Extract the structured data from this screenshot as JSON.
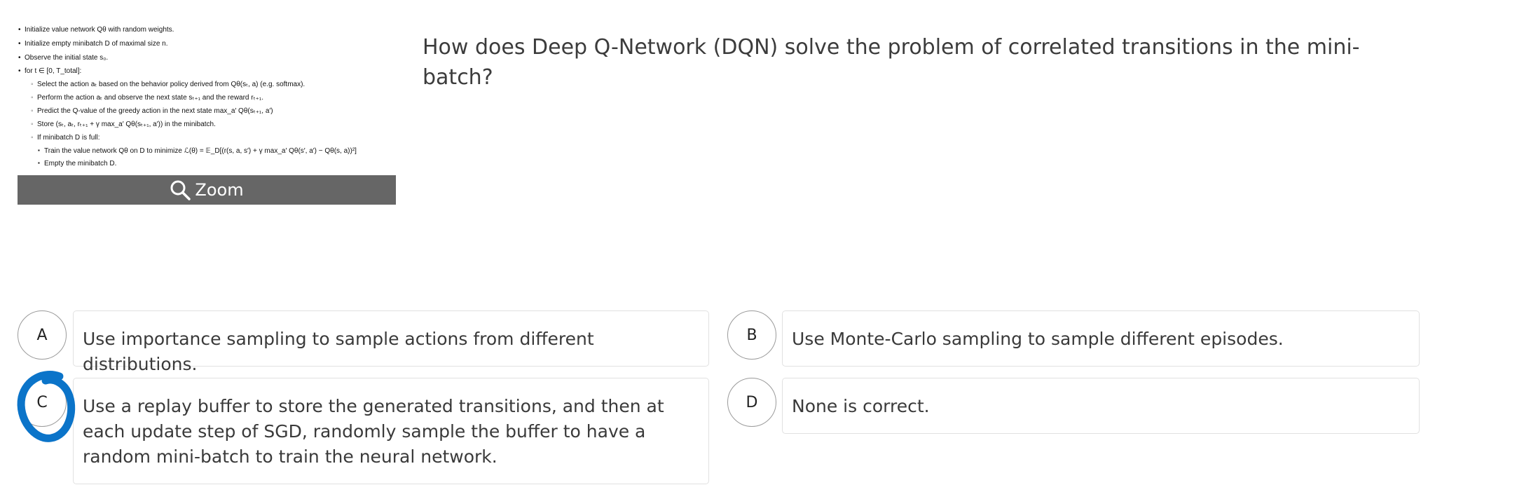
{
  "algorithm": {
    "lines": [
      "Initialize value network Qθ with random weights.",
      "Initialize empty minibatch D of maximal size n.",
      "Observe the initial state s₀.",
      "for t ∈ [0, T_total]:",
      "Select the action aₜ based on the behavior policy derived from Qθ(sₜ, a) (e.g. softmax).",
      "Perform the action aₜ and observe the next state sₜ₊₁ and the reward rₜ₊₁.",
      "Predict the Q-value of the greedy action in the next state max_a′ Qθ(sₜ₊₁, a′)",
      "Store (sₜ, aₜ, rₜ₊₁ + γ max_a′ Qθ(sₜ₊₁, a′)) in the minibatch.",
      "If minibatch D is full:",
      "Train the value network Qθ on D to minimize ℒ(θ) = 𝔼_D[(r(s, a, s′) + γ max_a′ Qθ(s′, a′) − Qθ(s, a))²]",
      "Empty the minibatch D."
    ]
  },
  "zoom": {
    "label": "Zoom",
    "icon": "magnifier-icon"
  },
  "question": "How does Deep Q-Network (DQN) solve the problem of correlated transitions in the mini-batch?",
  "options": [
    {
      "letter": "A",
      "text": "Use importance sampling to sample actions from different distributions."
    },
    {
      "letter": "B",
      "text": "Use Monte-Carlo sampling to sample different episodes."
    },
    {
      "letter": "C",
      "text": "Use a replay buffer to store the generated transitions, and then at each update step of SGD, randomly sample the buffer to have a random mini-batch to train the neural network."
    },
    {
      "letter": "D",
      "text": "None is correct."
    }
  ],
  "selection": {
    "letter": "C",
    "color": "#0b74c9"
  }
}
